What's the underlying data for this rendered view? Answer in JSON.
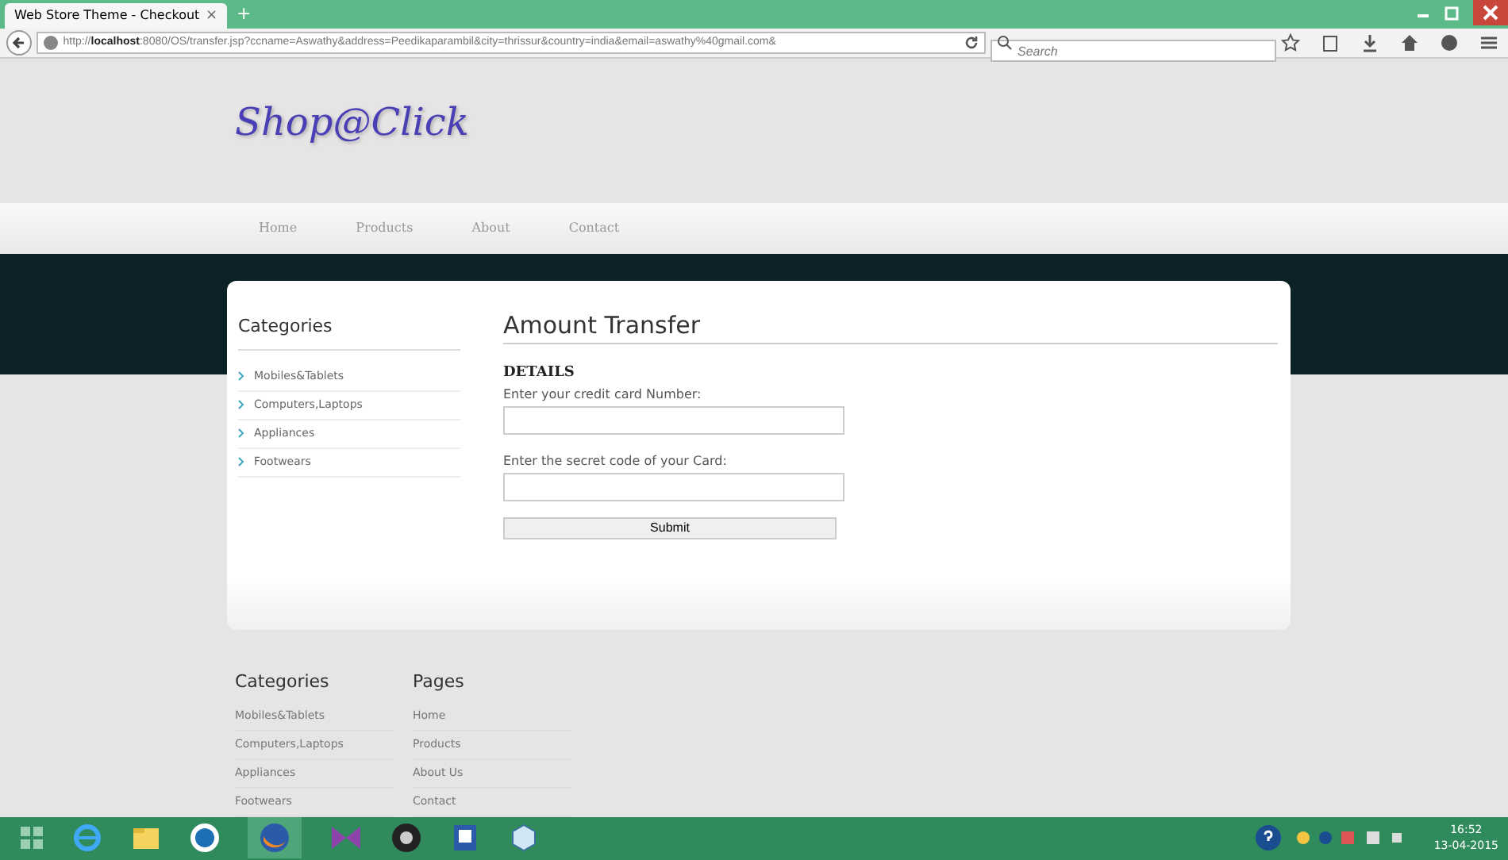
{
  "browser": {
    "tab_title": "Web Store Theme - Checkout",
    "tab_close": "×",
    "new_tab": "+",
    "url": "http://**localhost**:8080/OS/transfer.jsp?ccname=Aswathy&address=Peedikaparambil&city=thrissur&country=india&email=aswathy%40gmail.com&",
    "search": {
      "placeholder": "Search"
    }
  },
  "site": {
    "logo": "Shop@Click",
    "nav": [
      {
        "label": "Home"
      },
      {
        "label": "Products"
      },
      {
        "label": "About"
      },
      {
        "label": "Contact"
      }
    ]
  },
  "sidebar": {
    "title": "Categories",
    "items": [
      "Mobiles&Tablets",
      "Computers,Laptops",
      "Appliances",
      "Footwears"
    ]
  },
  "form": {
    "title": "Amount Transfer",
    "section": "DETAILS",
    "fields": [
      {
        "label": "Enter your credit card Number:"
      },
      {
        "label": "Enter the secret code of your Card:"
      }
    ],
    "submit": "Submit"
  },
  "footer": [
    {
      "title": "Categories",
      "links": [
        "Mobiles&Tablets",
        "Computers,Laptops",
        "Appliances",
        "Footwears"
      ]
    },
    {
      "title": "Pages",
      "links": [
        "Home",
        "Products",
        "About Us",
        "Contact"
      ]
    }
  ],
  "taskbar": {
    "time": "16:52",
    "date": "13-04-2015"
  }
}
